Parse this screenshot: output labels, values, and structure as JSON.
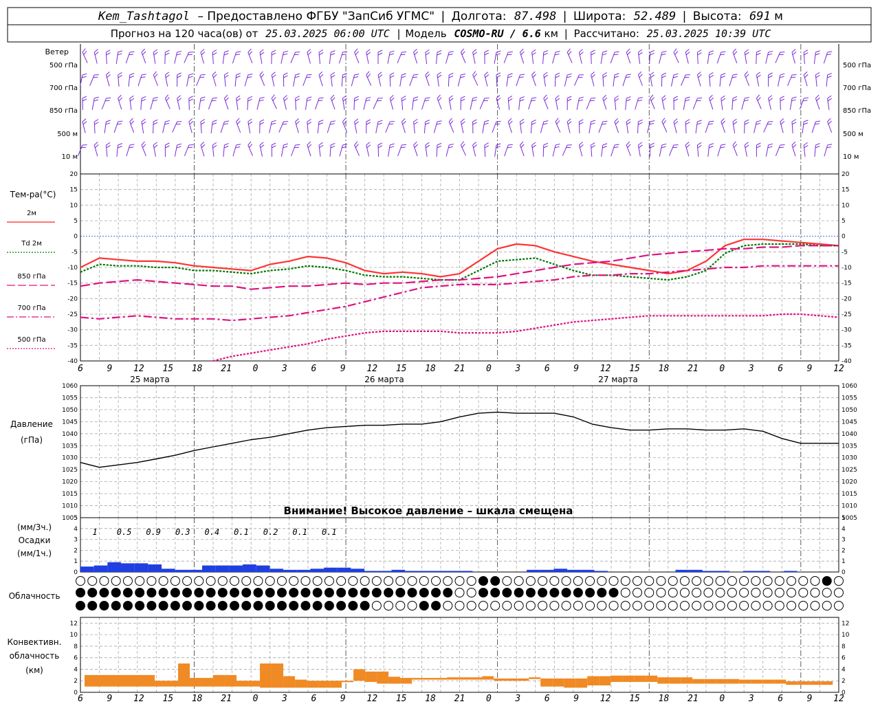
{
  "header": {
    "station": "Kem_Tashtagol",
    "provided": "– Предоставлено ФГБУ \"ЗапСиб УГМС\"",
    "lon_label": "Долгота:",
    "lon": "87.498",
    "lat_label": "Широта:",
    "lat": "52.489",
    "alt_label": "Высота:",
    "alt": "691",
    "alt_unit": "м",
    "forecast_label": "Прогноз на 120 часа(ов) от",
    "run_time": "25.03.2025 06:00 UTC",
    "model_label": "Модель",
    "model": "COSMO-RU / 6.6",
    "model_unit": "км",
    "calc_label": "Рассчитано:",
    "calc_time": "25.03.2025 10:39 UTC"
  },
  "wind": {
    "title": "Ветер",
    "levels": [
      "500 гПа",
      "700 гПа",
      "850 гПа",
      "500 м",
      "10  м"
    ]
  },
  "temperature": {
    "title": "Тем-ра(°C)",
    "legend": [
      {
        "label": "2м",
        "color": "#ff2222",
        "style": "solid"
      },
      {
        "label": "Td 2м",
        "color": "#007700",
        "style": "dotted"
      },
      {
        "label": "850 гПа",
        "color": "#e0107f",
        "style": "longdash"
      },
      {
        "label": "700 гПа",
        "color": "#e0107f",
        "style": "dashdot"
      },
      {
        "label": "500 гПа",
        "color": "#e0107f",
        "style": "dotted"
      }
    ],
    "y_ticks": [
      "20",
      "15",
      "10",
      "5",
      "0",
      "-5",
      "-10",
      "-15",
      "-20",
      "-25",
      "-30",
      "-35",
      "-40"
    ]
  },
  "time_axis": {
    "hour_labels": [
      "6",
      "9",
      "12",
      "15",
      "18",
      "21",
      "0",
      "3",
      "6",
      "9",
      "12",
      "15",
      "18",
      "21",
      "0",
      "3",
      "6",
      "9",
      "12",
      "15",
      "18",
      "21",
      "0",
      "3",
      "6",
      "9",
      "12"
    ],
    "day_labels": [
      "25 марта",
      "26 марта",
      "27 марта"
    ]
  },
  "pressure": {
    "title": "Давление",
    "unit": "(гПа)",
    "warning": "Внимание! Высокое давление – шкала смещена",
    "y_ticks": [
      "1060",
      "1055",
      "1050",
      "1045",
      "1040",
      "1035",
      "1030",
      "1025",
      "1020",
      "1015",
      "1010",
      "1005"
    ]
  },
  "precip": {
    "unit3h": "(мм/3ч.)",
    "title": "Осадки",
    "unit1h": "(мм/1ч.)",
    "y_ticks": [
      "5",
      "4",
      "3",
      "2",
      "1",
      "0"
    ],
    "totals": [
      "1",
      "0.5",
      "0.9",
      "0.3",
      "0.4",
      "0.1",
      "0.2",
      "0.1",
      "0.1"
    ]
  },
  "clouds": {
    "title": "Облачность"
  },
  "convective": {
    "title1": "Конвективн.",
    "title2": "облачность",
    "unit": "(км)",
    "y_ticks": [
      "12",
      "10",
      "8",
      "6",
      "4",
      "2",
      "0"
    ]
  },
  "colors": {
    "wind": "#7a28d8",
    "t2m": "#ff3333",
    "td": "#007700",
    "upper": "#e0107f",
    "pressure": "#000000",
    "precip": "#1f3fe0",
    "convective": "#f08a24",
    "grid": "#a8a8a8"
  },
  "chart_data": [
    {
      "type": "line",
      "title": "Тем-ра(°C)",
      "x_unit": "hours since 25.03.2025 06:00 UTC",
      "ylim": [
        -40,
        20
      ],
      "x": [
        0,
        3,
        6,
        9,
        12,
        15,
        18,
        21,
        24,
        27,
        30,
        33,
        36,
        39,
        42,
        45,
        48,
        51,
        54,
        57,
        60,
        63,
        66,
        69,
        72,
        75,
        78,
        81,
        84,
        87,
        90,
        93,
        96,
        99,
        102,
        105,
        108,
        111,
        114,
        117,
        120
      ],
      "series": [
        {
          "name": "2м",
          "values": [
            -10,
            -7,
            -7.5,
            -8,
            -8,
            -8.5,
            -9.5,
            -10,
            -10.5,
            -11,
            -9,
            -8,
            -6.5,
            -7,
            -8.5,
            -11,
            -12,
            -11.5,
            -12,
            -13,
            -12,
            -8,
            -4,
            -2.5,
            -3,
            -5,
            -6.5,
            -8,
            -9,
            -10,
            -11,
            -12,
            -11,
            -8,
            -3,
            -1,
            -1,
            -1.5,
            -2,
            -2.5,
            -3
          ]
        },
        {
          "name": "Td 2м",
          "values": [
            -11.5,
            -9,
            -9.5,
            -9.5,
            -10,
            -10,
            -11,
            -11,
            -11.5,
            -12,
            -11,
            -10.5,
            -9.5,
            -10,
            -11,
            -12.5,
            -13,
            -13,
            -13.5,
            -14,
            -14,
            -11,
            -8,
            -7.5,
            -7,
            -9,
            -11,
            -12.5,
            -12.5,
            -13,
            -13.5,
            -14,
            -13,
            -11,
            -5.5,
            -3,
            -2.5,
            -2.5,
            -2.5,
            -3,
            -3
          ]
        },
        {
          "name": "850 гПа",
          "values": [
            -16,
            -15,
            -14.5,
            -14,
            -14.5,
            -15,
            -15.5,
            -16,
            -16,
            -17,
            -16.5,
            -16,
            -16,
            -15.5,
            -15,
            -15.5,
            -15,
            -15,
            -14.5,
            -14,
            -14,
            -13.5,
            -13,
            -12,
            -11,
            -10,
            -9,
            -8.5,
            -8,
            -7,
            -6,
            -5.5,
            -5,
            -4.5,
            -4,
            -4,
            -3.5,
            -3.5,
            -3,
            -3,
            -3
          ]
        },
        {
          "name": "700 гПа",
          "values": [
            -26,
            -26.5,
            -26,
            -25.5,
            -26,
            -26.5,
            -26.5,
            -26.5,
            -27,
            -26.5,
            -26,
            -25.5,
            -24.5,
            -23.5,
            -22.5,
            -21,
            -19.5,
            -18,
            -16.5,
            -16,
            -15.5,
            -15.5,
            -15.5,
            -15,
            -14.5,
            -14,
            -13,
            -12.5,
            -12.5,
            -12,
            -12,
            -11.5,
            -11,
            -10.5,
            -10,
            -10,
            -9.5,
            -9.5,
            -9.5,
            -9.5,
            -9.5
          ]
        },
        {
          "name": "500 гПа",
          "values": [
            null,
            null,
            null,
            null,
            null,
            null,
            null,
            -40,
            -38.5,
            -37.5,
            -36.5,
            -35.5,
            -34.5,
            -33,
            -32,
            -31,
            -30.5,
            -30.5,
            -30.5,
            -30.5,
            -31,
            -31,
            -31,
            -30.5,
            -29.5,
            -28.5,
            -27.5,
            -27,
            -26.5,
            -26,
            -25.5,
            -25.5,
            -25.5,
            -25.5,
            -25.5,
            -25.5,
            -25.5,
            -25,
            -25,
            -25.5,
            -26
          ]
        }
      ]
    },
    {
      "type": "line",
      "title": "Давление",
      "ylabel": "(гПа)",
      "ylim": [
        1005,
        1060
      ],
      "x": [
        0,
        3,
        6,
        9,
        12,
        15,
        18,
        21,
        24,
        27,
        30,
        33,
        36,
        39,
        42,
        45,
        48,
        51,
        54,
        57,
        60,
        63,
        66,
        69,
        72,
        75,
        78,
        81,
        84,
        87,
        90,
        93,
        96,
        99,
        102,
        105,
        108,
        111,
        114,
        117,
        120
      ],
      "series": [
        {
          "name": "",
          "values": [
            1028,
            1026,
            1027,
            1028,
            1029.5,
            1031,
            1033,
            1034.5,
            1036,
            1037.5,
            1038.5,
            1040,
            1041.5,
            1042.5,
            1043,
            1043.5,
            1043.5,
            1044,
            1044,
            1045,
            1047,
            1048.5,
            1049,
            1048.5,
            1048.5,
            1048.5,
            1047,
            1044,
            1042.5,
            1041.5,
            1041.5,
            1042,
            1042,
            1041.5,
            1041.5,
            1042,
            1041,
            1038,
            1036,
            1036,
            1036
          ]
        }
      ]
    },
    {
      "type": "bar",
      "title": "Осадки",
      "ylabel": "(мм/1ч.)",
      "ylim": [
        0,
        5
      ],
      "x_start": 0,
      "x_step": 1,
      "values": [
        0.5,
        0.6,
        0.9,
        0.8,
        0.8,
        0.7,
        0.3,
        0.2,
        0.2,
        0.6,
        0.6,
        0.6,
        0.7,
        0.6,
        0.3,
        0.2,
        0.2,
        0.3,
        0.4,
        0.4,
        0.3,
        0.1,
        0.1,
        0.2,
        0.1,
        0.1,
        0.1,
        0.1,
        0.1,
        0,
        0,
        0,
        0,
        0.2,
        0.2,
        0.3,
        0.2,
        0.2,
        0.1,
        0,
        0,
        0,
        0,
        0,
        0.2,
        0.2,
        0.1,
        0.1,
        0,
        0.1,
        0.1,
        0,
        0.1,
        0,
        0,
        0
      ]
    },
    {
      "type": "bar",
      "title": "Конвективн. облачность",
      "ylabel": "(км)",
      "ylim": [
        0,
        13
      ],
      "series": [
        {
          "name": "",
          "x_start": 0,
          "x_step": 1,
          "base": [
            1,
            1,
            1,
            1,
            1,
            1,
            1,
            1,
            1,
            1,
            1,
            1,
            1,
            1,
            1,
            0.8,
            0.8,
            0.8,
            0.8,
            0.8,
            0.8,
            0.8,
            2,
            2,
            1.8,
            1.5,
            1.5,
            1.5,
            2.2,
            2.2,
            2.2,
            2.2,
            2.2,
            2.2,
            2.2,
            2,
            2,
            2,
            2.3,
            1,
            1,
            0.8,
            0.8,
            1.2,
            1.2,
            1.8,
            1.8,
            1.8,
            1.8,
            1.5,
            1.5,
            1.5,
            1.5,
            1.5,
            1.5,
            1.5,
            1.5,
            1.5,
            1.5,
            1.5,
            1.3,
            1.3,
            1.3,
            1.3
          ],
          "top": [
            3,
            3,
            3,
            3,
            3,
            3,
            2,
            2,
            5,
            2.5,
            2.5,
            3,
            3,
            2,
            2,
            5,
            5,
            2.8,
            2.2,
            2,
            2,
            2,
            2,
            4,
            3.6,
            3.6,
            2.7,
            2.5,
            2.5,
            2.5,
            2.5,
            2.6,
            2.6,
            2.6,
            2.8,
            2.4,
            2.4,
            2.4,
            2.6,
            2.4,
            2.4,
            2.4,
            2.4,
            2.8,
            2.8,
            2.9,
            2.9,
            2.9,
            2.9,
            2.6,
            2.6,
            2.6,
            2.3,
            2.3,
            2.3,
            2.3,
            2.2,
            2.2,
            2.2,
            2.2,
            1.9,
            1.9,
            1.9,
            1.9
          ]
        }
      ]
    }
  ]
}
